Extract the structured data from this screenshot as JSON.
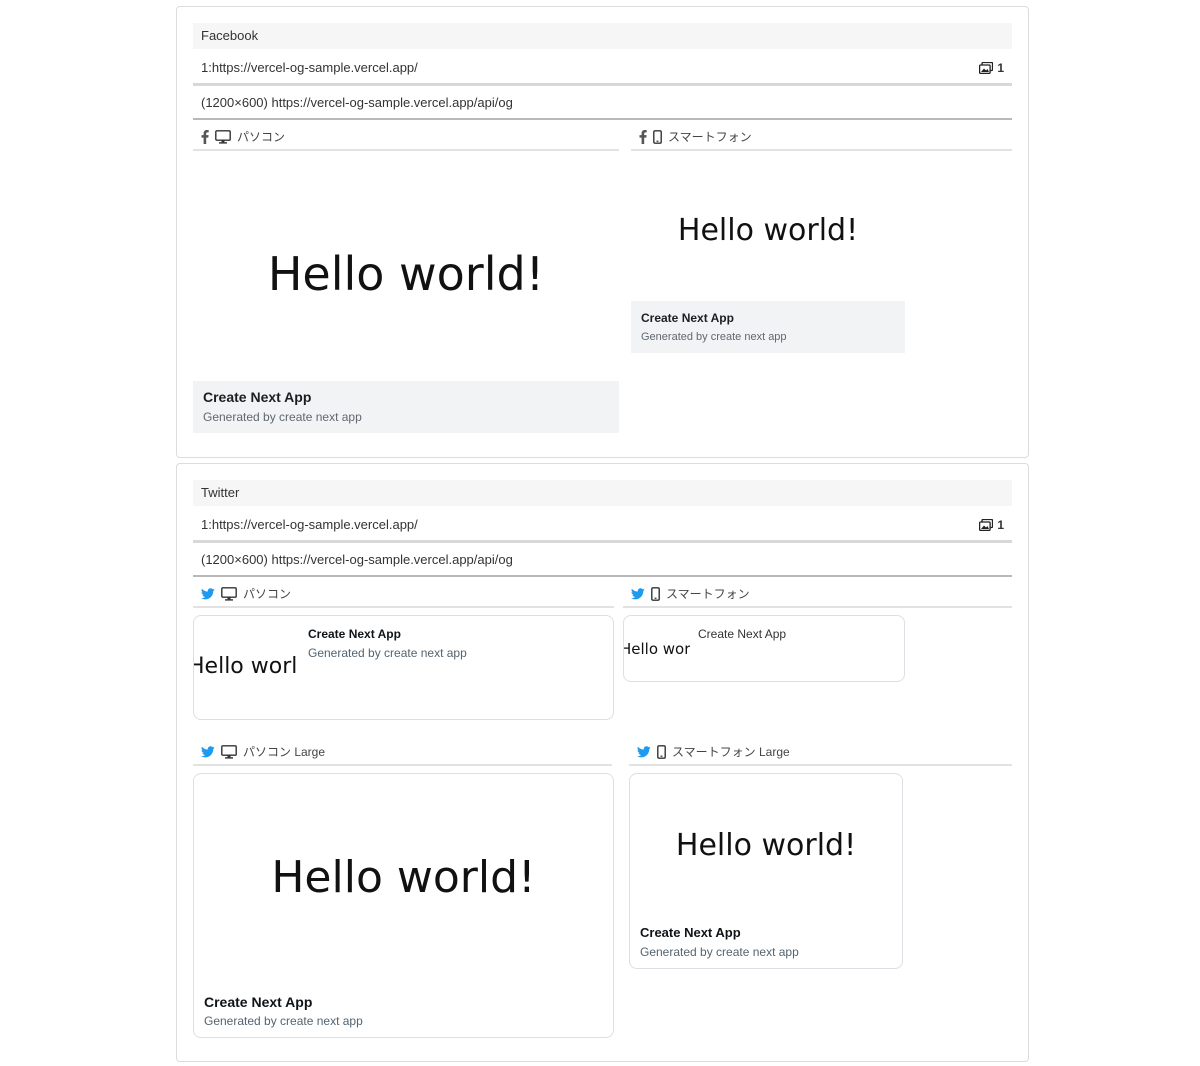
{
  "facebook": {
    "platform": "Facebook",
    "url_line": "1:https://vercel-og-sample.vercel.app/",
    "image_count": "1",
    "image_line": "(1200×600) https://vercel-og-sample.vercel.app/api/og",
    "pc_label": "パソコン",
    "sp_label": "スマートフォン",
    "og_text": "Hello world!",
    "title": "Create Next App",
    "description": "Generated by create next app"
  },
  "twitter": {
    "platform": "Twitter",
    "url_line": "1:https://vercel-og-sample.vercel.app/",
    "image_count": "1",
    "image_line": "(1200×600) https://vercel-og-sample.vercel.app/api/og",
    "pc_label": "パソコン",
    "sp_label": "スマートフォン",
    "pc_large_label": "パソコン Large",
    "sp_large_label": "スマートフォン Large",
    "og_text": "Hello world!",
    "og_text_cropped": "Hello world",
    "title": "Create Next App",
    "description": "Generated by create next app"
  },
  "icons": {
    "facebook": "facebook-icon",
    "twitter": "twitter-icon",
    "desktop": "desktop-icon",
    "mobile": "mobile-icon",
    "images": "images-icon"
  },
  "colors": {
    "twitter_blue": "#1d9bf0",
    "facebook_gray": "#555555",
    "meta_bg": "#f2f3f5"
  }
}
